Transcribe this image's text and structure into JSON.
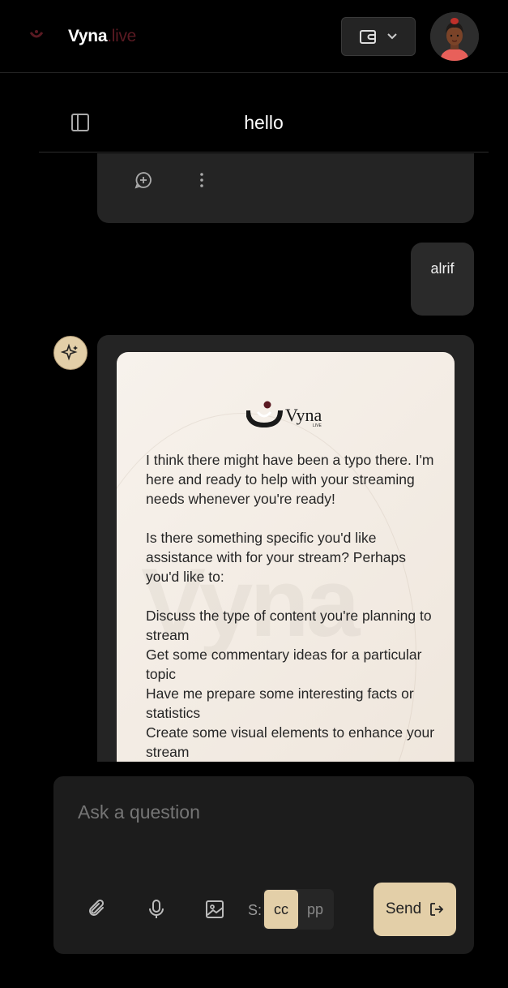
{
  "header": {
    "brand_name": "Vyna",
    "brand_suffix": ".live",
    "brand_color": "#5a1a22"
  },
  "chat": {
    "title": "hello",
    "user_message": "alrif",
    "ai_logo_text": "Vyna",
    "ai_logo_sub": "LIVE",
    "watermark": "Vyna",
    "ai_paragraphs": [
      "I think there might have been a typo there. I'm here and ready to help with your streaming needs whenever you're ready!",
      "Is there something specific you'd like assistance with for your stream? Perhaps you'd like to:"
    ],
    "ai_list": [
      "Discuss the type of content you're planning to stream",
      "Get some commentary ideas for a particular topic",
      "Have me prepare some interesting facts or statistics",
      "Create some visual elements to enhance your stream"
    ]
  },
  "composer": {
    "placeholder": "Ask a question",
    "s_label": "S:",
    "option_cc": "cc",
    "option_pp": "pp",
    "selected": "cc",
    "send_label": "Send"
  },
  "colors": {
    "accent": "#e3cfa8",
    "background": "#000000",
    "bubble": "#242424"
  }
}
